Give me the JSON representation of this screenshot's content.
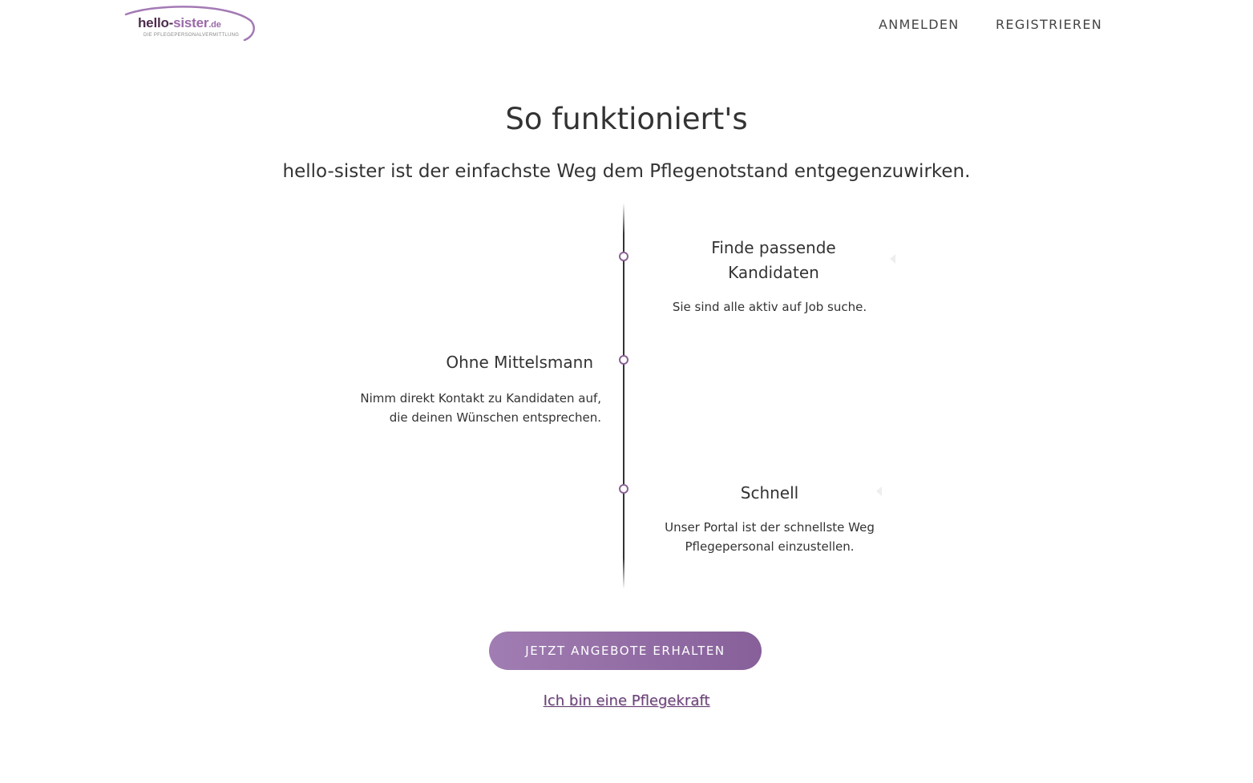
{
  "header": {
    "logo": {
      "name": "hello-",
      "name_accent": "sister",
      "tld": ".de",
      "tagline": "DIE PFLEGEPERSONALVERMITTLUNG",
      "colors": {
        "dark": "#4d2d4d",
        "accent": "#9a6aa8"
      }
    },
    "nav": {
      "login": "ANMELDEN",
      "register": "REGISTRIEREN"
    }
  },
  "main": {
    "title": "So funktioniert's",
    "subtitle": "hello-sister ist der einfachste Weg dem Pflegenotstand entgegenzuwirken.",
    "steps": [
      {
        "title": "Finde passende Kandidaten",
        "text": "Sie sind alle aktiv auf Job suche."
      },
      {
        "title": "Ohne Mittelsmann",
        "text": "Nimm direkt Kontakt zu Kandidaten auf, die deinen Wünschen entsprechen."
      },
      {
        "title": "Schnell",
        "text": "Unser Portal ist der schnellste Weg Pflegepersonal einzustellen."
      }
    ],
    "cta_label": "JETZT ANGEBOTE ERHALTEN",
    "nurse_link": "Ich bin eine Pflegekraft"
  },
  "colors": {
    "brand": "#8a6095",
    "cta_start": "#a07db2",
    "cta_end": "#87609a",
    "link": "#6b3f7a",
    "text": "#333333"
  }
}
